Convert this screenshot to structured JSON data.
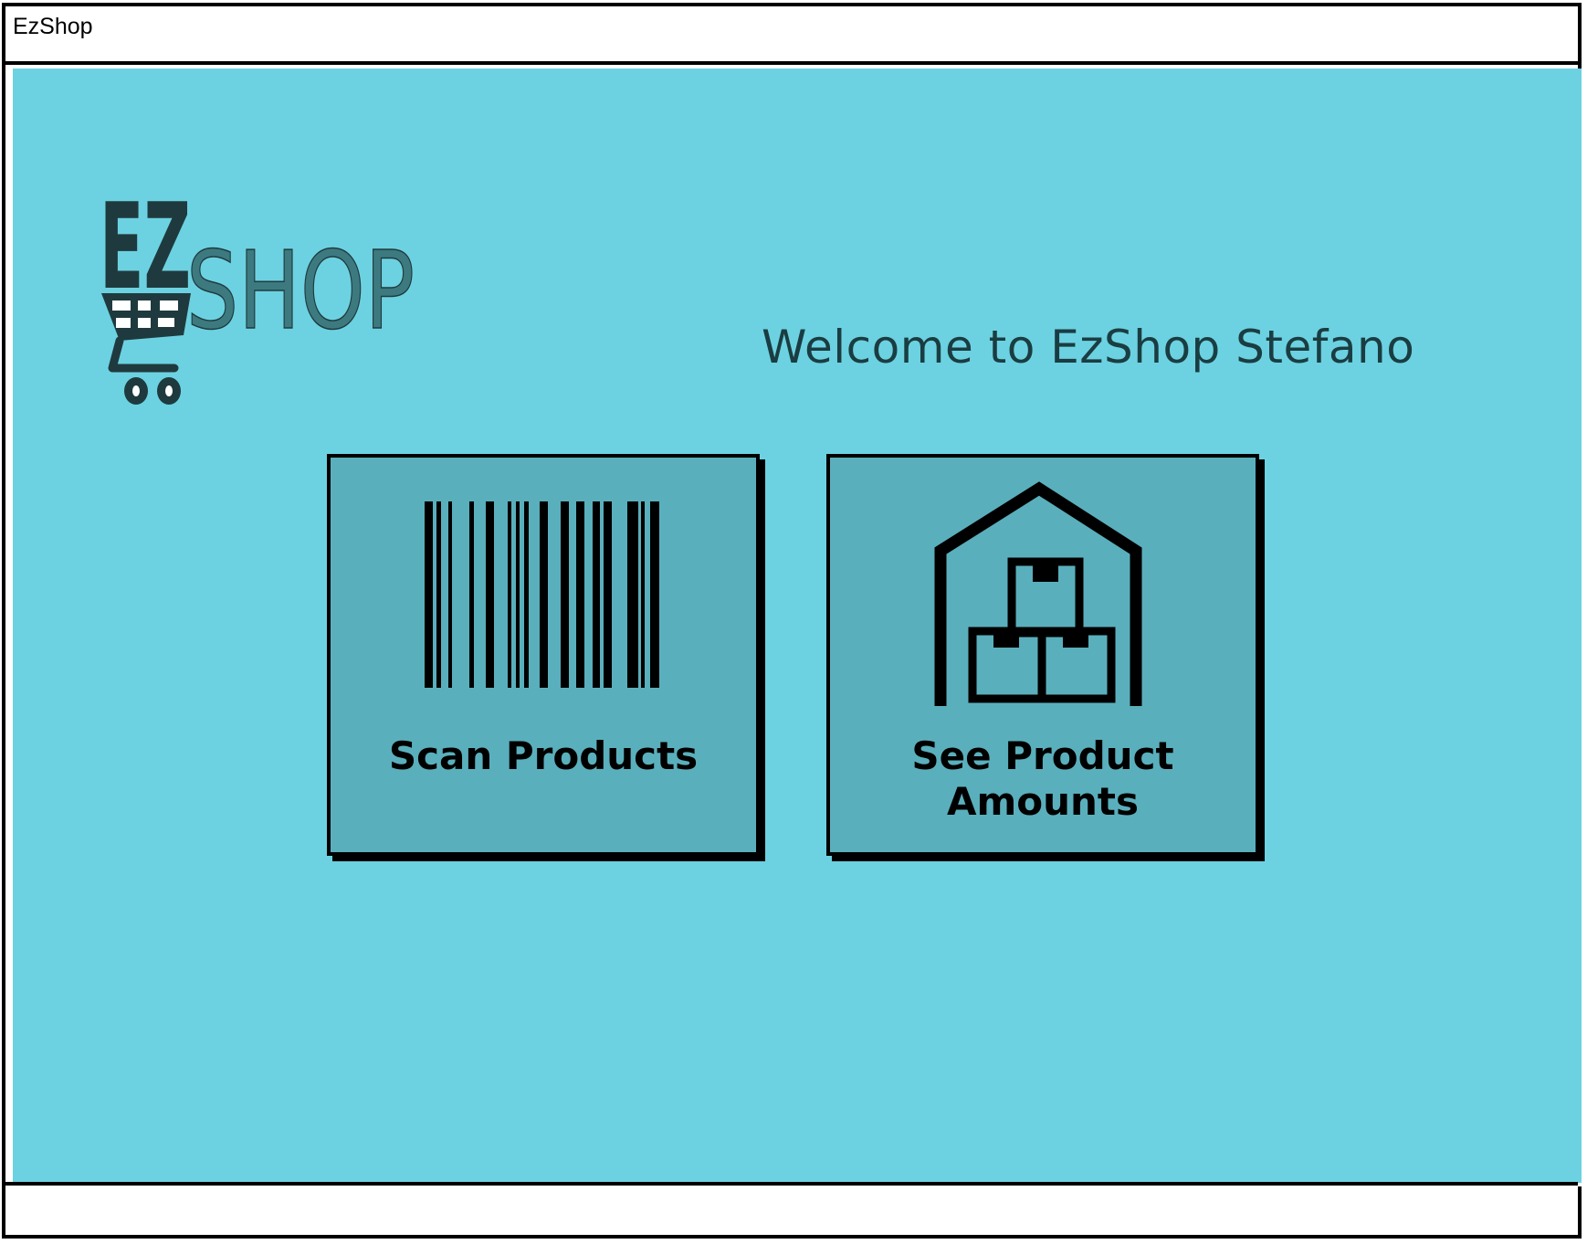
{
  "window": {
    "title": "EzShop"
  },
  "logo": {
    "brand_part1": "EZ",
    "brand_part2": "SHOP"
  },
  "main": {
    "welcome_text": "Welcome to EzShop Stefano",
    "tiles": [
      {
        "label": "Scan Products",
        "icon": "barcode-icon"
      },
      {
        "label": "See Product Amounts",
        "icon": "warehouse-boxes-icon"
      }
    ]
  },
  "colors": {
    "background": "#6cd2e1",
    "tile": "#5aafbc",
    "logo_dark": "#1f3a3e",
    "logo_light": "#3d7a80",
    "welcome_text": "#1a3d42"
  }
}
